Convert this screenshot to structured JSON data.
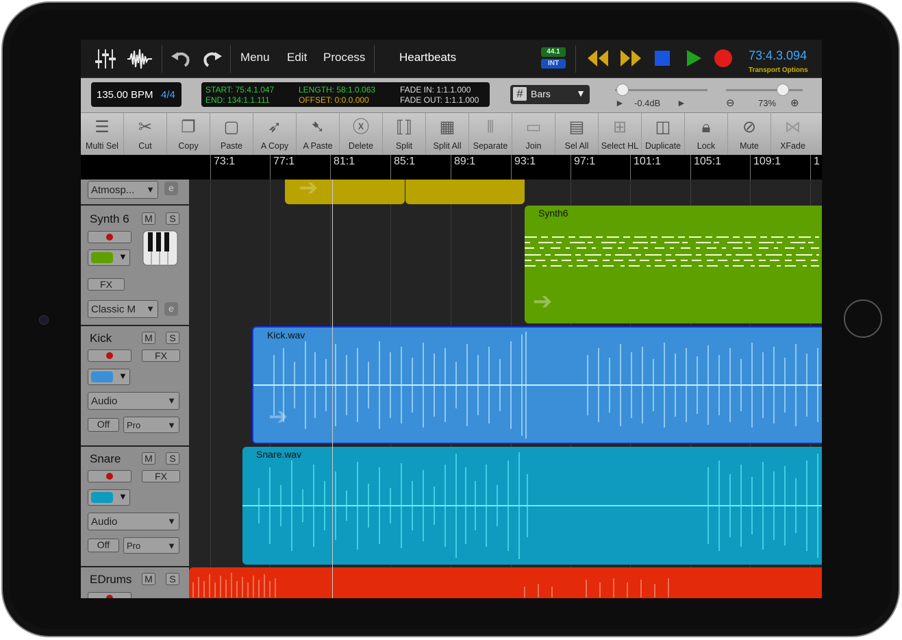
{
  "top": {
    "menus": [
      "Menu",
      "Edit",
      "Process"
    ],
    "song_title": "Heartbeats",
    "rate_top": "44.1",
    "rate_bottom": "INT",
    "position": "73:4.3.094",
    "transport_options": "Transport Options"
  },
  "info": {
    "bpm": "135.00 BPM",
    "signature": "4/4",
    "start": "START: 75:4.1.047",
    "end": "END: 134:1.1.111",
    "length": "LENGTH: 58:1.0.063",
    "offset": "OFFSET: 0:0.0.000",
    "fade_in": "FADE IN: 1:1.1.000",
    "fade_out": "FADE OUT: 1:1.1.000",
    "grid_mode": "Bars",
    "volume_db": "-0.4dB",
    "zoom": "73%"
  },
  "tools": [
    "Multi Sel",
    "Cut",
    "Copy",
    "Paste",
    "A Copy",
    "A Paste",
    "Delete",
    "Split",
    "Split All",
    "Separate",
    "Join",
    "Sel All",
    "Select HL",
    "Duplicate",
    "Lock",
    "Mute",
    "XFade"
  ],
  "ruler": [
    "73:1",
    "77:1",
    "81:1",
    "85:1",
    "89:1",
    "93:1",
    "97:1",
    "101:1",
    "105:1",
    "109:1",
    "1"
  ],
  "tracks": {
    "atmos": {
      "preset": "Atmosp...",
      "e": "e"
    },
    "synth": {
      "name": "Synth 6",
      "m": "M",
      "s": "S",
      "fx": "FX",
      "preset": "Classic M",
      "e": "e",
      "clip": "Synth6",
      "color": "#5ea000"
    },
    "kick": {
      "name": "Kick",
      "m": "M",
      "s": "S",
      "fx": "FX",
      "type": "Audio",
      "off": "Off",
      "mode": "Pro",
      "clip": "Kick.wav",
      "color": "#3a8fd8"
    },
    "snare": {
      "name": "Snare",
      "m": "M",
      "s": "S",
      "fx": "FX",
      "type": "Audio",
      "off": "Off",
      "mode": "Pro",
      "clip": "Snare.wav",
      "color": "#0f9bbf"
    },
    "edrums": {
      "name": "EDrums",
      "m": "M",
      "s": "S",
      "color": "#e32a0a"
    }
  }
}
